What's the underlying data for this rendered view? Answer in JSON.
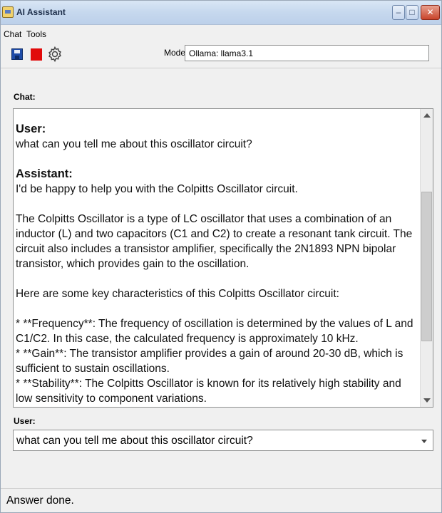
{
  "window": {
    "title": "AI Assistant",
    "controls": {
      "minimize": "–",
      "maximize": "□",
      "close": "✕"
    }
  },
  "menu": {
    "items": [
      "Chat",
      "Tools"
    ]
  },
  "toolbar": {
    "icons": [
      "save-icon",
      "stop-icon",
      "gear-icon"
    ],
    "model_label": "Model:",
    "model_value": "Ollama: llama3.1"
  },
  "chat": {
    "label": "Chat:",
    "user_role": "User:",
    "user_message": "what can you tell me about this oscillator circuit?",
    "assistant_role": "Assistant:",
    "assistant_paragraphs": [
      "I'd be happy to help you with the Colpitts Oscillator circuit.",
      "The Colpitts Oscillator is a type of LC oscillator that uses a combination of an inductor (L) and two capacitors (C1 and C2) to create a resonant tank circuit. The circuit also includes a transistor amplifier, specifically the 2N1893 NPN bipolar transistor, which provides gain to the oscillation.",
      "Here are some key characteristics of this Colpitts Oscillator circuit:",
      "* **Frequency**: The frequency of oscillation is determined by the values of L and C1/C2. In this case, the calculated frequency is approximately 10 kHz.\n* **Gain**: The transistor amplifier provides a gain of around 20-30 dB, which is sufficient to sustain oscillations.\n* **Stability**: The Colpitts Oscillator is known for its relatively high stability and low sensitivity to component variations."
    ]
  },
  "input": {
    "label": "User:",
    "value": "what can you tell me about this oscillator circuit?"
  },
  "status": {
    "text": "Answer done."
  },
  "colors": {
    "stop": "#e10b0b",
    "save": "#1f4ca8",
    "titlebar": "#c6d8ee"
  }
}
